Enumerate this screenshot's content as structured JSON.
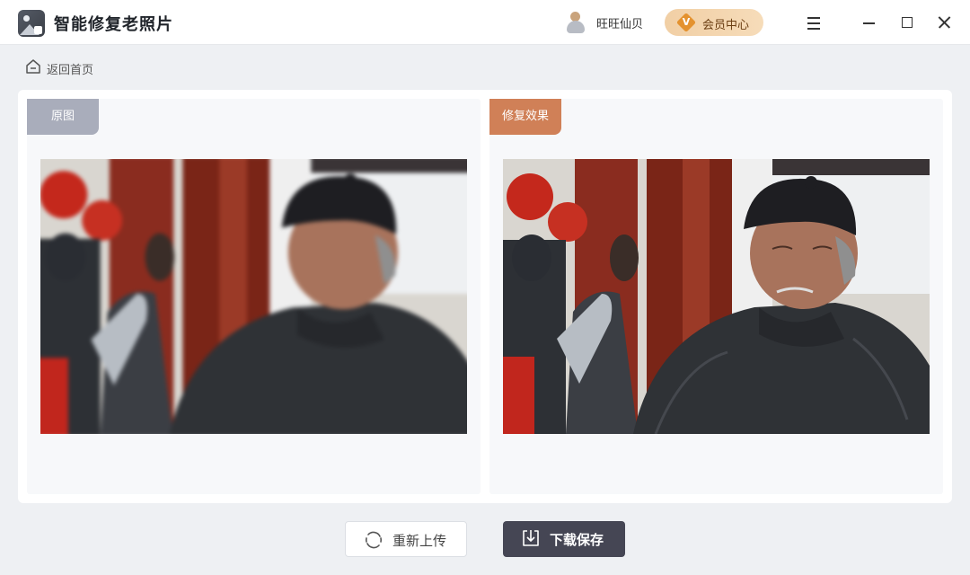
{
  "app": {
    "title": "智能修复老照片",
    "logo_icon": "photo-restore-logo-icon"
  },
  "user": {
    "name": "旺旺仙贝",
    "avatar_icon": "user-avatar-icon"
  },
  "vip": {
    "label": "会员中心",
    "icon_letter": "V",
    "accent": "#e4922f"
  },
  "window_controls": [
    "menu-icon",
    "minimize-icon",
    "maximize-icon",
    "close-icon"
  ],
  "nav": {
    "back_label": "返回首页",
    "back_icon": "home-icon"
  },
  "compare": {
    "original_label": "原图",
    "restored_label": "修复效果",
    "original_badge_color": "#a9adbb",
    "restored_badge_color": "#d08057"
  },
  "actions": {
    "reupload_label": "重新上传",
    "reupload_icon": "refresh-icon",
    "save_label": "下载保存",
    "save_icon": "download-icon"
  }
}
